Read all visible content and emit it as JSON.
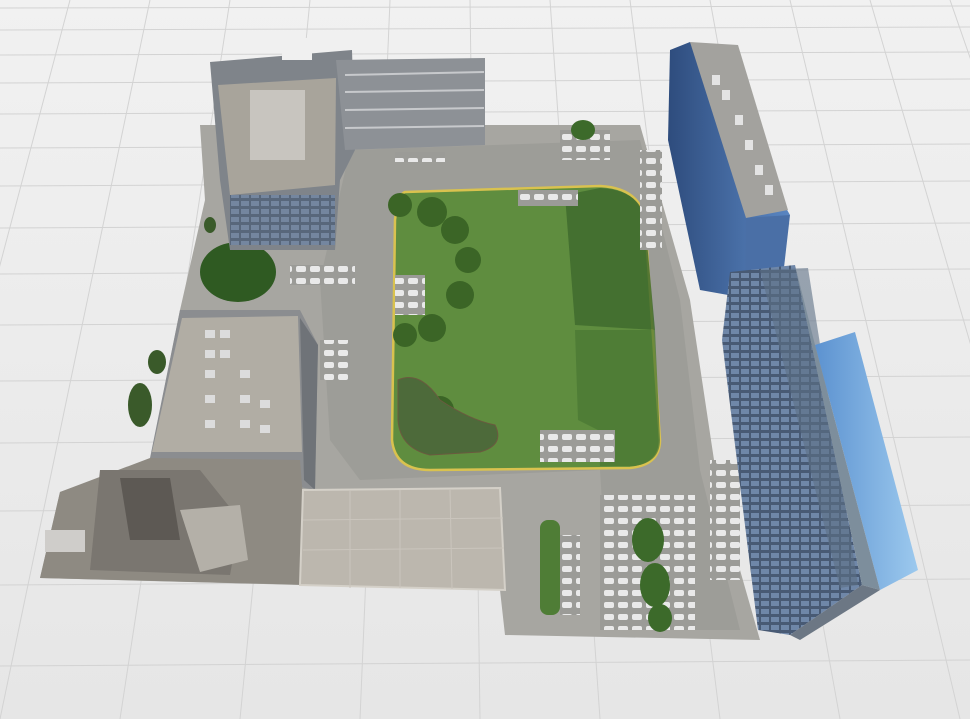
{
  "scene": {
    "description_hidden": "",
    "colors": {
      "floor": "#ececec",
      "grid_line": "#d4d4d4",
      "lawn": "#5a8a3c",
      "lawn_shade": "#3f6a2c",
      "asphalt": "#a9a9a4",
      "asphalt_dark": "#8c8c88",
      "roof": "#a8a39a",
      "roof_dark": "#7d7a73",
      "facade_gray": "#8a8f95",
      "facade_blue": "#3b5f96",
      "facade_light_blue": "#6aa3dc",
      "curb_yellow": "#d8c050",
      "tree": "#3e6a2a"
    },
    "icons": [
      "building-icon",
      "tree-icon",
      "car-icon"
    ]
  }
}
